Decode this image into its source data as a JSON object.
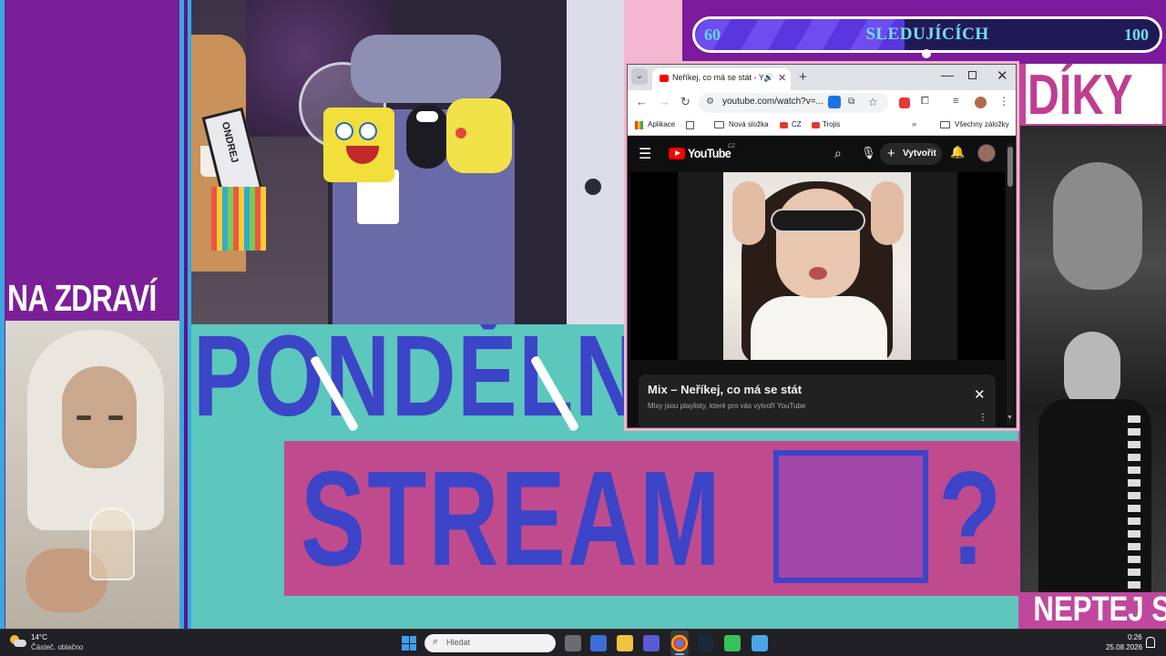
{
  "overlay": {
    "left_label": "NA ZDRAVÍ",
    "title_line1": "PONDĚLNÍ",
    "title_line2": "STREAM",
    "question_mark": "?",
    "right_top_label": "DÍKY",
    "right_bottom_label": "NEPTEJ SE",
    "plate_text": "ONDREJ"
  },
  "follower_goal": {
    "min": "60",
    "label": "SLEDUJÍCÍCH",
    "max": "100",
    "progress_fraction": 0.45
  },
  "browser": {
    "tab_title": "Neříkej, co má se stát - You",
    "url": "youtube.com/watch?v=...",
    "bookmarks": {
      "apps": "Aplikace",
      "folder": "Nová složka",
      "cz": "CZ",
      "trojis": "Trojis",
      "all": "Všechny záložky"
    }
  },
  "youtube": {
    "logo_text": "YouTube",
    "country": "CZ",
    "create_label": "Vytvořit",
    "mix_title": "Mix – Neříkej, co má se stát",
    "mix_subtitle": "Mixy jsou playlisty, které pro vás vytvoří YouTube"
  },
  "taskbar": {
    "temperature": "14°C",
    "weather": "Částeč. oblačno",
    "search_placeholder": "Hledat",
    "time": "0:26",
    "date": "25.08.2026"
  },
  "colors": {
    "accent_blue": "#3c44c8",
    "purple": "#7a1f98",
    "teal": "#5cc7bd",
    "pink": "#bf4b8e",
    "youtube_red": "#ff0000"
  }
}
